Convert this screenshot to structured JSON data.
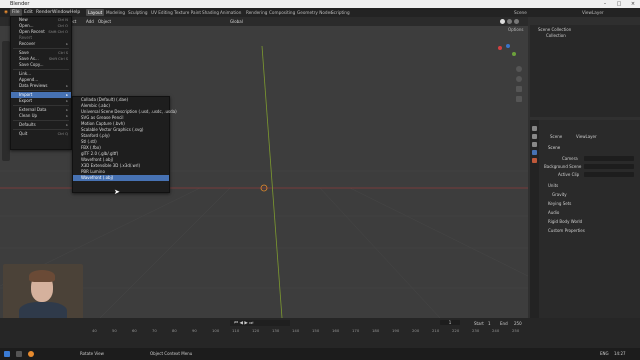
{
  "window": {
    "title": "Blender"
  },
  "topbar": {
    "menus": [
      "File",
      "Edit",
      "Render",
      "Window",
      "Help"
    ],
    "workspaces": [
      "Layout",
      "Modeling",
      "Sculpting",
      "UV Editing",
      "Texture Paint",
      "Shading",
      "Animation",
      "Rendering",
      "Compositing",
      "Geometry Nodes",
      "Scripting"
    ],
    "scene": "Scene",
    "view_layer": "ViewLayer"
  },
  "header3d": {
    "items": [
      "Object Mode",
      "View",
      "Select",
      "Add",
      "Object"
    ],
    "transform": "Global",
    "options": "Options"
  },
  "file_menu": {
    "items": [
      {
        "label": "New",
        "shortcut": "Ctrl N"
      },
      {
        "label": "Open...",
        "shortcut": "Ctrl O"
      },
      {
        "label": "Open Recent",
        "shortcut": "Shift Ctrl O"
      },
      {
        "label": "Revert",
        "shortcut": ""
      },
      {
        "label": "Recover",
        "shortcut": ""
      },
      {
        "label": "Save",
        "shortcut": "Ctrl S"
      },
      {
        "label": "Save As...",
        "shortcut": "Shift Ctrl S"
      },
      {
        "label": "Save Copy...",
        "shortcut": ""
      },
      {
        "label": "Link...",
        "shortcut": ""
      },
      {
        "label": "Append...",
        "shortcut": ""
      },
      {
        "label": "Data Previews",
        "shortcut": ""
      },
      {
        "label": "Import",
        "shortcut": ""
      },
      {
        "label": "Export",
        "shortcut": ""
      },
      {
        "label": "External Data",
        "shortcut": ""
      },
      {
        "label": "Clean Up",
        "shortcut": ""
      },
      {
        "label": "Defaults",
        "shortcut": ""
      },
      {
        "label": "Quit",
        "shortcut": "Ctrl Q"
      }
    ]
  },
  "import_menu": {
    "items": [
      "Collada (Default) (.dae)",
      "Alembic (.abc)",
      "Universal Scene Description (.usd, .usdc, .usda)",
      "SVG as Grease Pencil",
      "Motion Capture (.bvh)",
      "Scalable Vector Graphics (.svg)",
      "Stanford (.ply)",
      "Stl (.stl)",
      "FBX (.fbx)",
      "glTF 2.0 (.glb/.gltf)",
      "Wavefront (.obj)",
      "X3D Extensible 3D (.x3d/.wrl)",
      "PBR Lumino",
      "Wavefront (.obj)"
    ],
    "highlighted": "Wavefront (.obj)"
  },
  "outliner": {
    "scene_collection": "Scene Collection",
    "collection": "Collection"
  },
  "properties": {
    "breadcrumb_scene": "Scene",
    "breadcrumb_layer": "ViewLayer",
    "section_scene": "Scene",
    "camera_label": "Camera",
    "background_label": "Background Scene",
    "active_clip_label": "Active Clip",
    "sections": [
      "Units",
      "Gravity",
      "Keying Sets",
      "Audio",
      "Rigid Body World",
      "Custom Properties"
    ]
  },
  "timeline": {
    "ticks": [
      "40",
      "50",
      "60",
      "70",
      "80",
      "90",
      "100",
      "110",
      "120",
      "130",
      "140",
      "150",
      "160",
      "170",
      "180",
      "190",
      "200",
      "210",
      "220",
      "230",
      "240",
      "250"
    ],
    "current_frame": "1",
    "start_label": "Start",
    "start_value": "1",
    "end_label": "End",
    "end_value": "250"
  },
  "statusbar": {
    "left": "Rotate View",
    "middle": "Object Context Menu",
    "lang": "ENG",
    "time": "14:27"
  }
}
